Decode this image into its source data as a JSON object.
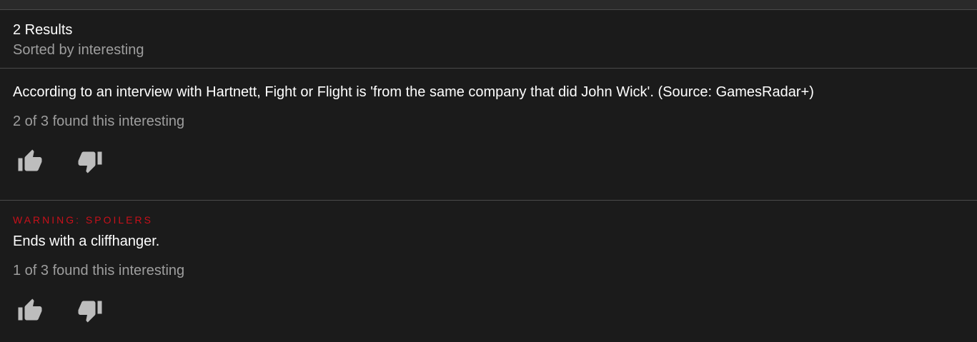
{
  "header": {
    "count_label": "2 Results",
    "sort_label": "Sorted by interesting"
  },
  "items": [
    {
      "spoiler": "",
      "text": "According to an interview with Hartnett, Fight or Flight is 'from the same company that did John Wick'. (Source: GamesRadar+)",
      "interest": "2 of 3 found this interesting"
    },
    {
      "spoiler": "WARNING: SPOILERS",
      "text": "Ends with a cliffhanger.",
      "interest": "1 of 3 found this interesting"
    }
  ],
  "icons": {
    "upvote": "thumb-up-icon",
    "downvote": "thumb-down-icon"
  },
  "colors": {
    "background": "#1b1b1b",
    "spoiler": "#c8101a",
    "muted_text": "#9e9e9e",
    "icon": "#bdbdbd"
  }
}
